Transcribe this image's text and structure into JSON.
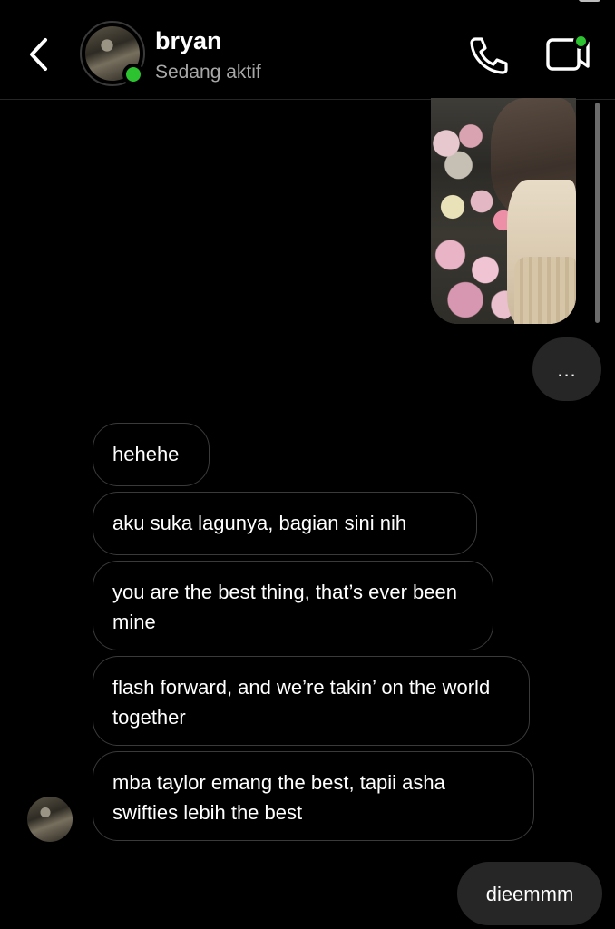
{
  "header": {
    "contact_name": "bryan",
    "contact_status": "Sedang aktif"
  },
  "thread": {
    "more_label": "...",
    "received": [
      {
        "text": "hehehe"
      },
      {
        "text": "aku suka lagunya, bagian sini nih"
      },
      {
        "text": "you are the best thing, that’s ever been mine"
      },
      {
        "text": "flash forward, and we’re takin’ on the world together"
      },
      {
        "text": "mba taylor emang the best, tapii asha swifties lebih the best"
      }
    ],
    "sent_last": "dieemmm"
  },
  "colors": {
    "background": "#000000",
    "online_green": "#2dc22f",
    "sent_bubble": "#262626",
    "received_border": "#3a3a3a",
    "secondary_text": "#a8a8a8"
  },
  "icons": [
    "chevron-left-icon",
    "phone-icon",
    "video-camera-icon",
    "more-dots-icon"
  ]
}
